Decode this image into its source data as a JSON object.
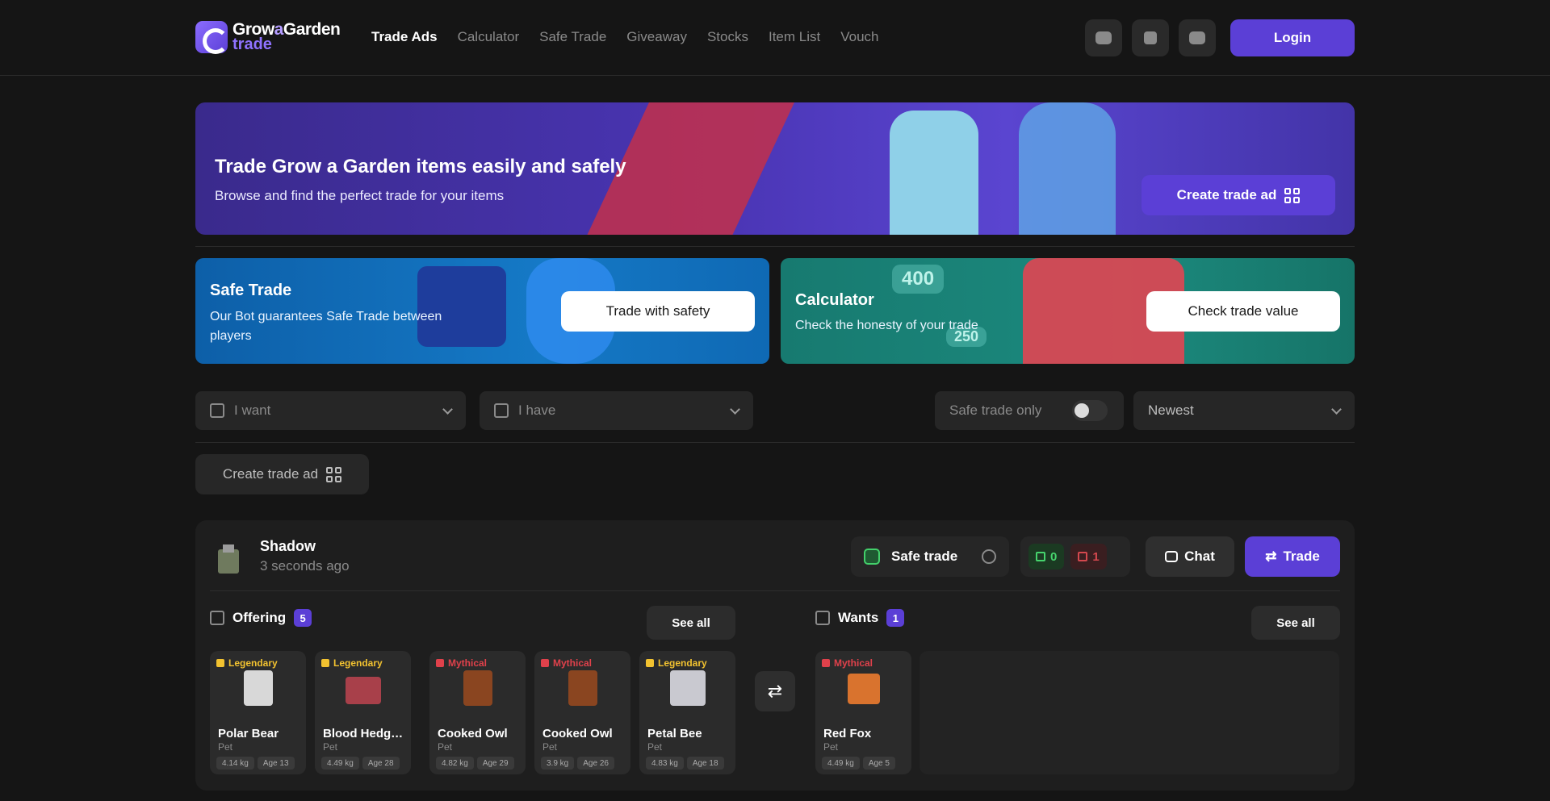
{
  "header": {
    "logo_line1a": "Grow",
    "logo_line1b": "a",
    "logo_line1c": "Garden",
    "logo_line2": "trade",
    "nav": [
      "Trade Ads",
      "Calculator",
      "Safe Trade",
      "Giveaway",
      "Stocks",
      "Item List",
      "Vouch"
    ],
    "active_nav": "Trade Ads",
    "social_icons": [
      "discord-icon",
      "instagram-icon",
      "youtube-icon"
    ],
    "login_label": "Login"
  },
  "hero": {
    "title": "Trade Grow a Garden items easily and safely",
    "subtitle": "Browse and find the perfect trade for your items",
    "button": "Create trade ad"
  },
  "cards": {
    "safe": {
      "title": "Safe Trade",
      "subtitle": "Our Bot guarantees Safe Trade between players",
      "button": "Trade with safety"
    },
    "calc": {
      "title": "Calculator",
      "subtitle": "Check the honesty of your trade",
      "button": "Check trade value",
      "chip1": "400",
      "chip2": "250"
    }
  },
  "filters": {
    "want_placeholder": "I want",
    "have_placeholder": "I have",
    "safe_only": "Safe trade only",
    "safe_only_on": false,
    "sort": "Newest"
  },
  "create_button": "Create trade ad",
  "ad": {
    "user": "Shadow",
    "time": "3 seconds ago",
    "safe_label": "Safe trade",
    "upvotes": "0",
    "downvotes": "1",
    "chat": "Chat",
    "trade": "Trade",
    "offering_label": "Offering",
    "offering_count": "5",
    "wants_label": "Wants",
    "wants_count": "1",
    "see_all": "See all",
    "offering": [
      {
        "rarity": "Legendary",
        "name": "Polar Bear",
        "type": "Pet",
        "weight": "4.14 kg",
        "age": "Age 13"
      },
      {
        "rarity": "Legendary",
        "name": "Blood Hedgehog",
        "type": "Pet",
        "weight": "4.49 kg",
        "age": "Age 28"
      },
      {
        "rarity": "Mythical",
        "name": "Cooked Owl",
        "type": "Pet",
        "weight": "4.82 kg",
        "age": "Age 29"
      },
      {
        "rarity": "Mythical",
        "name": "Cooked Owl",
        "type": "Pet",
        "weight": "3.9 kg",
        "age": "Age 26"
      },
      {
        "rarity": "Legendary",
        "name": "Petal Bee",
        "type": "Pet",
        "weight": "4.83 kg",
        "age": "Age 18"
      }
    ],
    "wants": [
      {
        "rarity": "Mythical",
        "name": "Red Fox",
        "type": "Pet",
        "weight": "4.49 kg",
        "age": "Age 5"
      }
    ]
  },
  "colors": {
    "accent": "#5b3fd6",
    "legendary": "#f2c230",
    "mythical": "#e0414b"
  }
}
